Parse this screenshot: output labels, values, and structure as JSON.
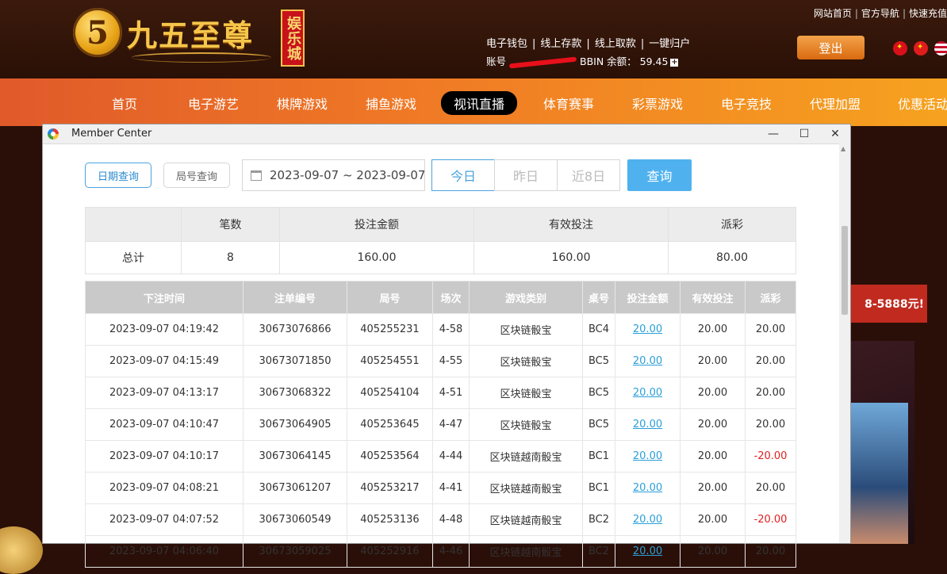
{
  "site": {
    "logo_digit": "5",
    "logo_text": "九五至尊",
    "logo_badge": "娱乐城",
    "top_links": [
      "网站首页",
      "官方导航",
      "快速充值"
    ],
    "wallet_links": [
      "电子钱包",
      "线上存款",
      "线上取款",
      "一键归户"
    ],
    "account_label": "账号",
    "balance_label": "BBIN 余额：",
    "balance_value": "59.45",
    "logout_label": "登出",
    "nav": [
      "首页",
      "电子游艺",
      "棋牌游戏",
      "捕鱼游戏",
      "视讯直播",
      "体育赛事",
      "彩票游戏",
      "电子竞技",
      "代理加盟",
      "优惠活动"
    ],
    "nav_active": "视讯直播",
    "promo_text": "8-5888元!"
  },
  "window": {
    "title": "Member Center",
    "controls": {
      "minimize": "—",
      "maximize": "☐",
      "close": "✕"
    }
  },
  "filters": {
    "mode_date": "日期查询",
    "mode_round": "局号查询",
    "date_range": "2023-09-07 ~ 2023-09-07",
    "quick_ranges": [
      "今日",
      "昨日",
      "近8日"
    ],
    "quick_active": "今日",
    "query_button": "查询"
  },
  "summary": {
    "headers": [
      "",
      "笔数",
      "投注金额",
      "有效投注",
      "派彩"
    ],
    "row": [
      "总计",
      "8",
      "160.00",
      "160.00",
      "80.00"
    ]
  },
  "bets": {
    "headers": [
      "下注时间",
      "注单编号",
      "局号",
      "场次",
      "游戏类别",
      "桌号",
      "投注金额",
      "有效投注",
      "派彩"
    ],
    "rows": [
      [
        "2023-09-07 04:19:42",
        "30673076866",
        "405255231",
        "4-58",
        "区块链骰宝",
        "BC4",
        "20.00",
        "20.00",
        "20.00"
      ],
      [
        "2023-09-07 04:15:49",
        "30673071850",
        "405254551",
        "4-55",
        "区块链骰宝",
        "BC5",
        "20.00",
        "20.00",
        "20.00"
      ],
      [
        "2023-09-07 04:13:17",
        "30673068322",
        "405254104",
        "4-51",
        "区块链骰宝",
        "BC5",
        "20.00",
        "20.00",
        "20.00"
      ],
      [
        "2023-09-07 04:10:47",
        "30673064905",
        "405253645",
        "4-47",
        "区块链骰宝",
        "BC5",
        "20.00",
        "20.00",
        "20.00"
      ],
      [
        "2023-09-07 04:10:17",
        "30673064145",
        "405253564",
        "4-44",
        "区块链越南骰宝",
        "BC1",
        "20.00",
        "20.00",
        "-20.00"
      ],
      [
        "2023-09-07 04:08:21",
        "30673061207",
        "405253217",
        "4-41",
        "区块链越南骰宝",
        "BC1",
        "20.00",
        "20.00",
        "20.00"
      ],
      [
        "2023-09-07 04:07:52",
        "30673060549",
        "405253136",
        "4-48",
        "区块链越南骰宝",
        "BC2",
        "20.00",
        "20.00",
        "-20.00"
      ],
      [
        "2023-09-07 04:06:40",
        "30673059025",
        "405252916",
        "4-46",
        "区块链越南骰宝",
        "BC2",
        "20.00",
        "20.00",
        "20.00"
      ]
    ]
  },
  "colors": {
    "accent": "#4fb2ef",
    "negative": "#e0201e",
    "link": "#2a9fd8",
    "nav_active_bg": "#000000"
  }
}
